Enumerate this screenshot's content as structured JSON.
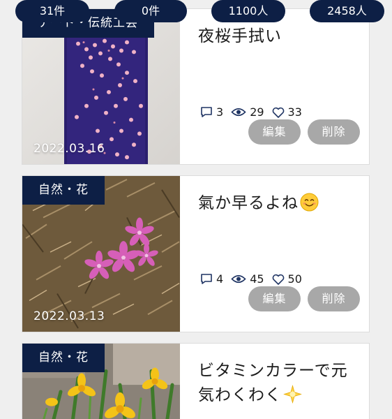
{
  "counts": [
    {
      "label": "31件"
    },
    {
      "label": "0件"
    },
    {
      "label": "1100人"
    },
    {
      "label": "2458人"
    }
  ],
  "posts": [
    {
      "category": "アート・伝統工芸",
      "date": "2022.03.16",
      "title": "夜桜手拭い",
      "comments": "3",
      "views": "29",
      "likes": "33",
      "edit_label": "編集",
      "delete_label": "削除"
    },
    {
      "category": "自然・花",
      "date": "2022.03.13",
      "title": "氣か早るよね",
      "title_emoji": "smiling-face-emoji",
      "comments": "4",
      "views": "45",
      "likes": "50",
      "edit_label": "編集",
      "delete_label": "削除"
    },
    {
      "category": "自然・花",
      "title": "ビタミンカラーで元気わくわく",
      "title_emoji": "sparkle-star-emoji"
    }
  ],
  "colors": {
    "navy": "#0d1f45",
    "button_gray": "#a8a8a8",
    "background": "#efefef"
  }
}
